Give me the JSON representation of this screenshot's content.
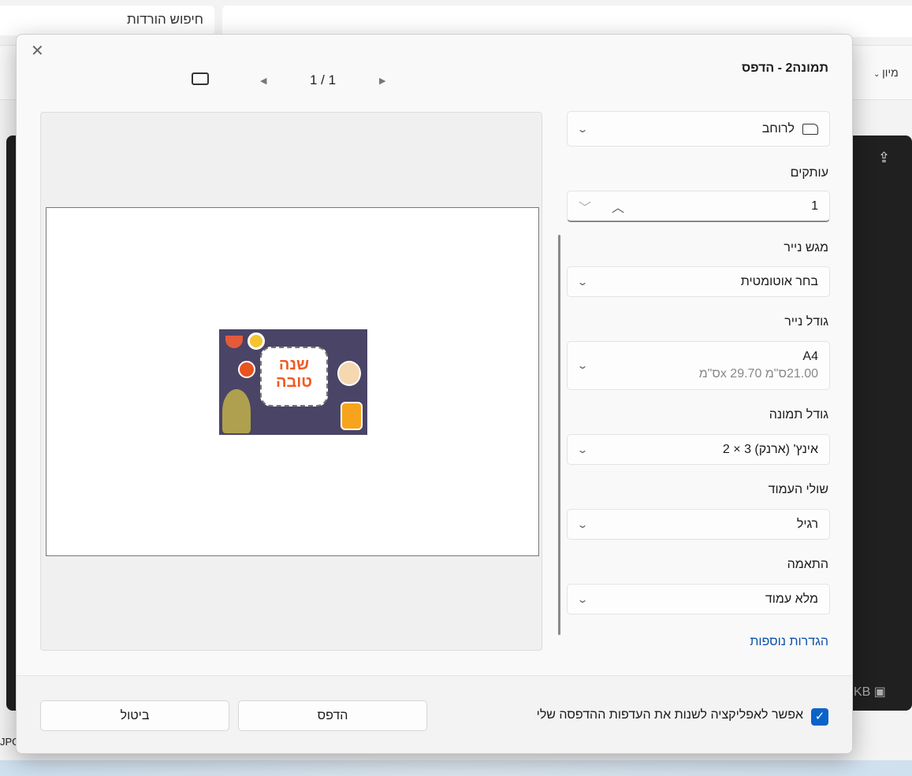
{
  "background": {
    "search_text": "חיפוש הורדות",
    "sort_label": "מיון",
    "status_left": "JPG",
    "status_right": "KB"
  },
  "dialog": {
    "title": "תמונה2 - הדפס",
    "close_icon": "close-icon",
    "pager": {
      "text": "1 / 1",
      "prev_icon": "triangle-left-icon",
      "next_icon": "triangle-right-icon",
      "fit_icon": "fit-page-icon"
    },
    "preview_image": {
      "caption_line1": "שנה",
      "caption_line2": "טובה"
    },
    "orientation": {
      "value": "לרוחב",
      "icon": "landscape-page-icon"
    },
    "copies": {
      "label": "עותקים",
      "value": "1"
    },
    "paper_tray": {
      "label": "מגש נייר",
      "value": "בחר אוטומטית"
    },
    "paper_size": {
      "label": "גודל נייר",
      "value": "A4",
      "detail": "21.00ס\"מ x 29.70ס\"מ"
    },
    "photo_size": {
      "label": "גודל תמונה",
      "value": "אינץ' (ארנק) 3 × 2"
    },
    "margins": {
      "label": "שולי העמוד",
      "value": "רגיל"
    },
    "fit": {
      "label": "התאמה",
      "value": "מלא עמוד"
    },
    "more_settings": "הגדרות נוספות",
    "allow_app_label": "אפשר לאפליקציה לשנות את העדפות ההדפסה שלי",
    "allow_app_checked": true,
    "print_button": "הדפס",
    "cancel_button": "ביטול",
    "accent_color": "#0a63c9"
  }
}
